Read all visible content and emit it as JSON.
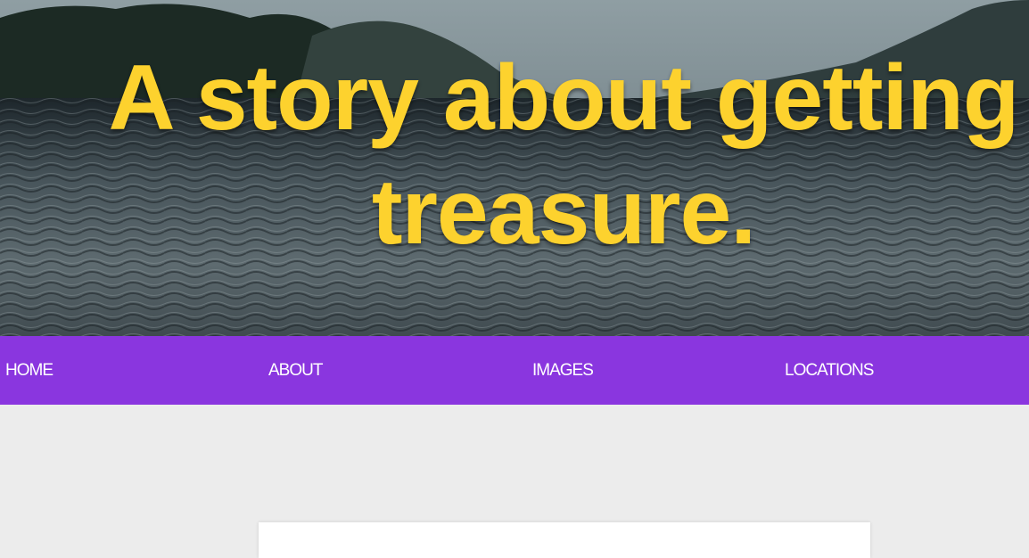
{
  "hero": {
    "title": "A story about getting treasure."
  },
  "nav": {
    "items": [
      {
        "label": "HOME"
      },
      {
        "label": "ABOUT"
      },
      {
        "label": "IMAGES"
      },
      {
        "label": "LOCATIONS"
      }
    ]
  },
  "colors": {
    "title": "#fdd22e",
    "nav_background": "#8a36df",
    "nav_text": "#ffffff",
    "page_background": "#ececec"
  }
}
